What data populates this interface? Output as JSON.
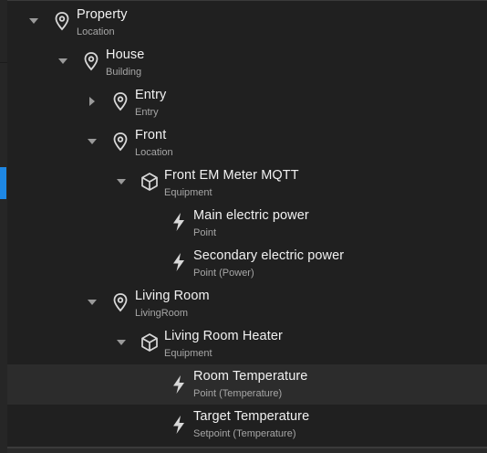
{
  "tree": {
    "nodes": [
      {
        "title": "Property",
        "subtitle": "Location",
        "icon": "location-pin-icon",
        "toggle": "expanded"
      },
      {
        "title": "House",
        "subtitle": "Building",
        "icon": "location-pin-icon",
        "toggle": "expanded"
      },
      {
        "title": "Entry",
        "subtitle": "Entry",
        "icon": "location-pin-icon",
        "toggle": "collapsed"
      },
      {
        "title": "Front",
        "subtitle": "Location",
        "icon": "location-pin-icon",
        "toggle": "expanded"
      },
      {
        "title": "Front EM Meter MQTT",
        "subtitle": "Equipment",
        "icon": "cube-icon",
        "toggle": "expanded"
      },
      {
        "title": "Main electric power",
        "subtitle": "Point",
        "icon": "lightning-bolt-icon",
        "toggle": "none"
      },
      {
        "title": "Secondary electric power",
        "subtitle": "Point (Power)",
        "icon": "lightning-bolt-icon",
        "toggle": "none"
      },
      {
        "title": "Living Room",
        "subtitle": "LivingRoom",
        "icon": "location-pin-icon",
        "toggle": "expanded"
      },
      {
        "title": "Living Room Heater",
        "subtitle": "Equipment",
        "icon": "cube-icon",
        "toggle": "expanded"
      },
      {
        "title": "Room Temperature",
        "subtitle": "Point (Temperature)",
        "icon": "lightning-bolt-icon",
        "toggle": "none"
      },
      {
        "title": "Target Temperature",
        "subtitle": "Setpoint (Temperature)",
        "icon": "lightning-bolt-icon",
        "toggle": "none"
      }
    ]
  },
  "colors": {
    "accent": "#1e88e5",
    "text": "#f2f2f2",
    "subtext": "#a6a6a6"
  }
}
